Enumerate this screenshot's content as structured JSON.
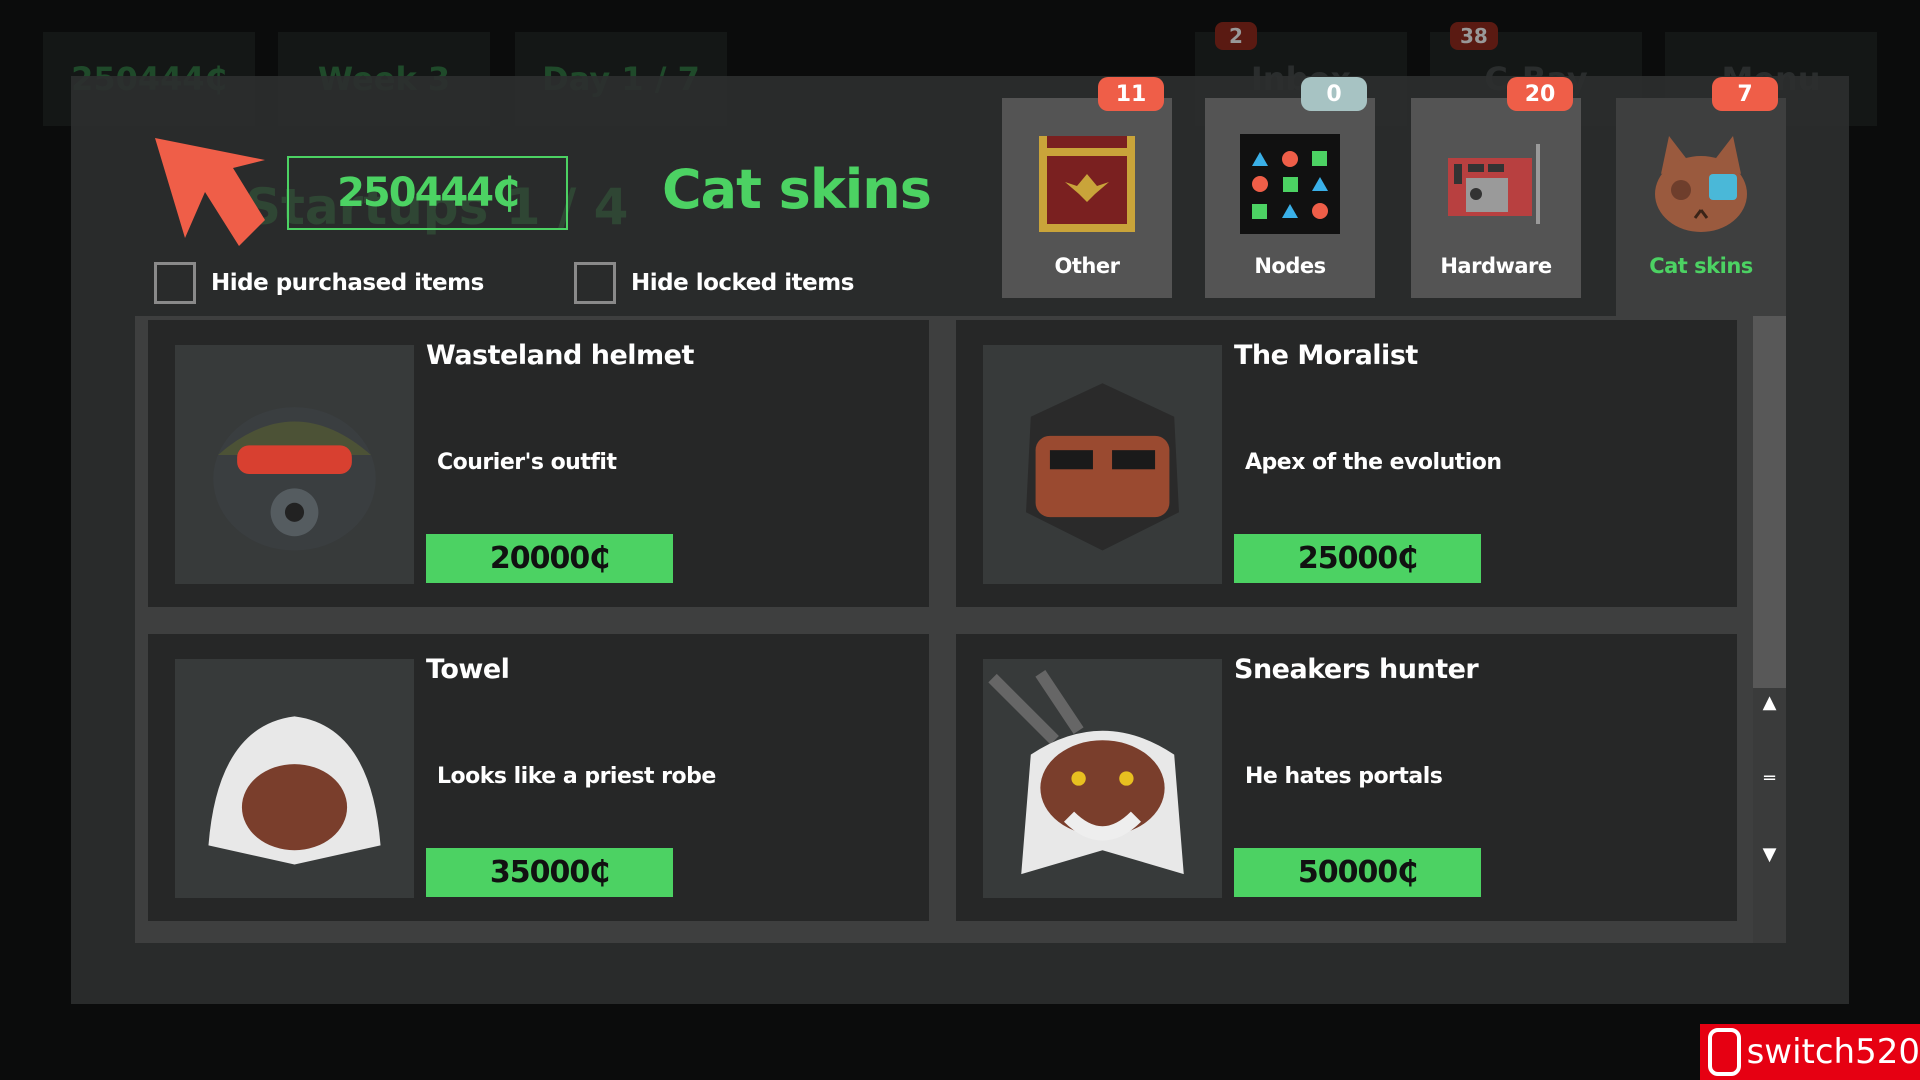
{
  "background_hud": {
    "money": "250444₵",
    "week": "Week 3",
    "day": "Day 1 / 7",
    "inbox": "Inbox",
    "inbox_count": "2",
    "cbay": "C-Bay",
    "cbay_count": "38",
    "menu": "Menu",
    "startups": "Startups 1 / 4"
  },
  "header": {
    "money": "250444₵",
    "title": "Cat skins"
  },
  "filters": [
    {
      "label": "Hide purchased items",
      "checked": false
    },
    {
      "label": "Hide locked items",
      "checked": false
    }
  ],
  "tabs": [
    {
      "label": "Other",
      "badge": "11",
      "icon": "imperial-banner-icon"
    },
    {
      "label": "Nodes",
      "badge": "0",
      "icon": "node-shapes-icon"
    },
    {
      "label": "Hardware",
      "badge": "20",
      "icon": "graphics-card-icon"
    },
    {
      "label": "Cat skins",
      "badge": "7",
      "icon": "cat-cyborg-icon",
      "active": true
    }
  ],
  "items": [
    {
      "name": "Wasteland helmet",
      "desc": "Courier's outfit",
      "price": "20000₵"
    },
    {
      "name": "The Moralist",
      "desc": "Apex of the evolution",
      "price": "25000₵"
    },
    {
      "name": "Towel",
      "desc": "Looks like a priest robe",
      "price": "35000₵"
    },
    {
      "name": "Sneakers hunter",
      "desc": "He hates portals",
      "price": "50000₵"
    }
  ],
  "watermark": "switch520",
  "colors": {
    "accent": "#4cd263",
    "badge": "#ef5e48",
    "badge_zero": "#a7c3c3"
  }
}
